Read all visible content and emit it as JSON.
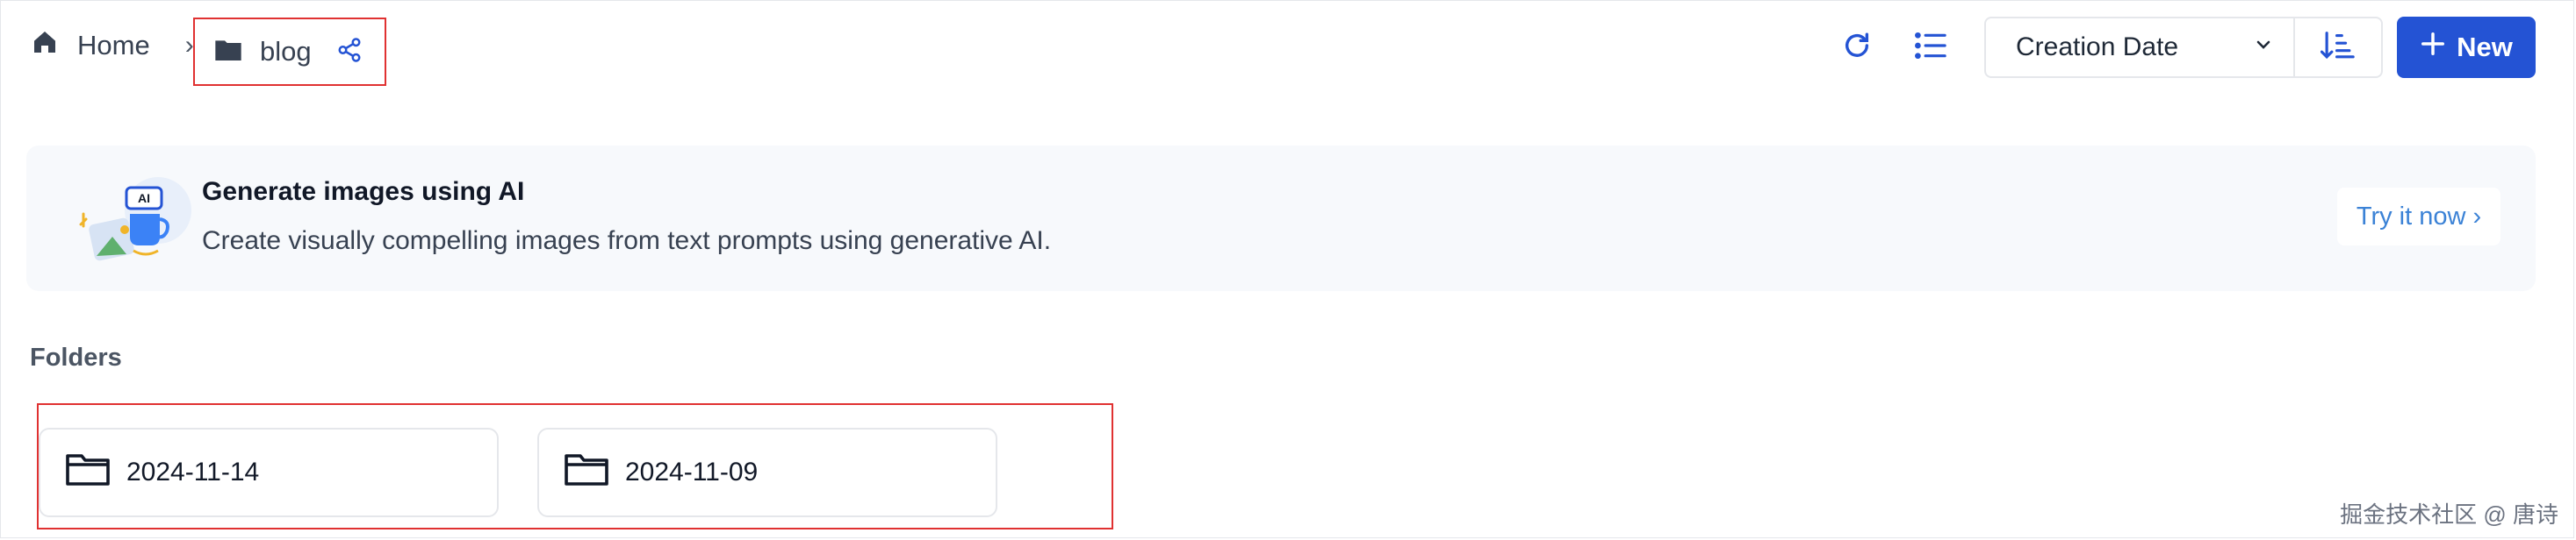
{
  "breadcrumb": {
    "home_label": "Home",
    "separator": "›",
    "current_label": "blog"
  },
  "toolbar": {
    "sort_value": "Creation Date",
    "new_label": "New"
  },
  "banner": {
    "title": "Generate images using AI",
    "description": "Create visually compelling images from text prompts using generative AI.",
    "cta_label": "Try it now ›",
    "badge_text": "AI"
  },
  "folders_section": {
    "title": "Folders"
  },
  "folders": [
    {
      "name": "2024-11-14"
    },
    {
      "name": "2024-11-09"
    }
  ],
  "watermark": "掘金技术社区 @ 唐诗",
  "colors": {
    "accent": "#2453d4",
    "link": "#3b82d6",
    "highlight_border": "#e03131"
  },
  "icons": [
    "home-icon",
    "folder-icon",
    "share-icon",
    "refresh-icon",
    "list-view-icon",
    "chevron-down-icon",
    "sort-icon",
    "plus-icon"
  ]
}
